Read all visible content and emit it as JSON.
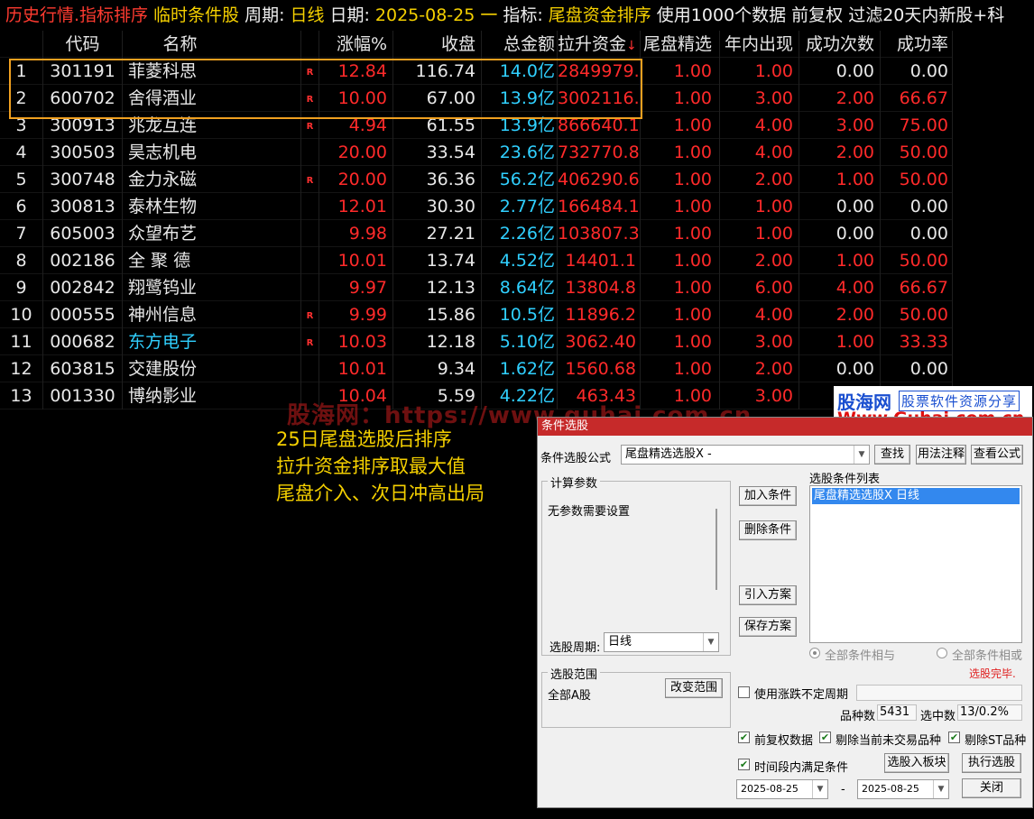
{
  "header": {
    "title": "历史行情.指标排序",
    "mode": "临时条件股",
    "period_label": "周期:",
    "period_value": "日线",
    "date_label": "日期:",
    "date_value": "2025-08-25 一",
    "indicator_label": "指标:",
    "indicator_value": "尾盘资金排序",
    "tail": "使用1000个数据 前复权 过滤20天内新股+科"
  },
  "table": {
    "columns": [
      "代码",
      "名称",
      "涨幅%",
      "收盘",
      "总金额",
      "拉升资金",
      "尾盘精选",
      "年内出现",
      "成功次数",
      "成功率"
    ],
    "sort_indicator": "↓",
    "rows": [
      {
        "idx": "1",
        "code": "301191",
        "name": "菲菱科思",
        "flag": "R",
        "chg": "12.84",
        "close": "116.74",
        "amount": "14.0亿",
        "fund": "2849979.0",
        "tail": "1.00",
        "year": "1.00",
        "succ": "0.00",
        "rate": "0.00"
      },
      {
        "idx": "2",
        "code": "600702",
        "name": "舍得酒业",
        "flag": "R",
        "chg": "10.00",
        "close": "67.00",
        "amount": "13.9亿",
        "fund": "3002116.8",
        "tail": "1.00",
        "year": "3.00",
        "succ": "2.00",
        "rate": "66.67"
      },
      {
        "idx": "3",
        "code": "300913",
        "name": "兆龙互连",
        "flag": "R",
        "chg": "4.94",
        "close": "61.55",
        "amount": "13.9亿",
        "fund": "866640.1",
        "tail": "1.00",
        "year": "4.00",
        "succ": "3.00",
        "rate": "75.00"
      },
      {
        "idx": "4",
        "code": "300503",
        "name": "昊志机电",
        "flag": "",
        "chg": "20.00",
        "close": "33.54",
        "amount": "23.6亿",
        "fund": "732770.8",
        "tail": "1.00",
        "year": "4.00",
        "succ": "2.00",
        "rate": "50.00"
      },
      {
        "idx": "5",
        "code": "300748",
        "name": "金力永磁",
        "flag": "R",
        "chg": "20.00",
        "close": "36.36",
        "amount": "56.2亿",
        "fund": "406290.6",
        "tail": "1.00",
        "year": "2.00",
        "succ": "1.00",
        "rate": "50.00"
      },
      {
        "idx": "6",
        "code": "300813",
        "name": "泰林生物",
        "flag": "",
        "chg": "12.01",
        "close": "30.30",
        "amount": "2.77亿",
        "fund": "166484.1",
        "tail": "1.00",
        "year": "1.00",
        "succ": "0.00",
        "rate": "0.00"
      },
      {
        "idx": "7",
        "code": "605003",
        "name": "众望布艺",
        "flag": "",
        "chg": "9.98",
        "close": "27.21",
        "amount": "2.26亿",
        "fund": "103807.3",
        "tail": "1.00",
        "year": "1.00",
        "succ": "0.00",
        "rate": "0.00"
      },
      {
        "idx": "8",
        "code": "002186",
        "name": "全 聚 德",
        "flag": "",
        "chg": "10.01",
        "close": "13.74",
        "amount": "4.52亿",
        "fund": "14401.1",
        "tail": "1.00",
        "year": "2.00",
        "succ": "1.00",
        "rate": "50.00"
      },
      {
        "idx": "9",
        "code": "002842",
        "name": "翔鹭钨业",
        "flag": "",
        "chg": "9.97",
        "close": "12.13",
        "amount": "8.64亿",
        "fund": "13804.8",
        "tail": "1.00",
        "year": "6.00",
        "succ": "4.00",
        "rate": "66.67"
      },
      {
        "idx": "10",
        "code": "000555",
        "name": "神州信息",
        "flag": "R",
        "chg": "9.99",
        "close": "15.86",
        "amount": "10.5亿",
        "fund": "11896.2",
        "tail": "1.00",
        "year": "4.00",
        "succ": "2.00",
        "rate": "50.00"
      },
      {
        "idx": "11",
        "code": "000682",
        "name": "东方电子",
        "flag": "R",
        "chg": "10.03",
        "close": "12.18",
        "amount": "5.10亿",
        "fund": "3062.40",
        "tail": "1.00",
        "year": "3.00",
        "succ": "1.00",
        "rate": "33.33"
      },
      {
        "idx": "12",
        "code": "603815",
        "name": "交建股份",
        "flag": "",
        "chg": "10.01",
        "close": "9.34",
        "amount": "1.62亿",
        "fund": "1560.68",
        "tail": "1.00",
        "year": "2.00",
        "succ": "0.00",
        "rate": "0.00"
      },
      {
        "idx": "13",
        "code": "001330",
        "name": "博纳影业",
        "flag": "",
        "chg": "10.04",
        "close": "5.59",
        "amount": "4.22亿",
        "fund": "463.43",
        "tail": "1.00",
        "year": "3.00",
        "succ": "",
        "rate": ""
      }
    ]
  },
  "watermark": "股海网：https://www.guhai.com.cn",
  "notes": [
    "25日尾盘选股后排序",
    "拉升资金排序取最大值",
    "尾盘介入、次日冲高出局"
  ],
  "logo": {
    "name": "股海网",
    "slogan": "股票软件资源分享",
    "url": "Www.Guhai.com.cn"
  },
  "dialog": {
    "title": "条件选股",
    "formula_label": "条件选股公式",
    "formula_value": "尾盘精选选股X  -",
    "btn_find": "查找",
    "btn_usage": "用法注释",
    "btn_view": "查看公式",
    "params_group": "计算参数",
    "params_text": "无参数需要设置",
    "period_label": "选股周期:",
    "period_value": "日线",
    "btn_add": "加入条件",
    "btn_delete": "删除条件",
    "btn_import": "引入方案",
    "btn_save": "保存方案",
    "list_label": "选股条件列表",
    "list_items": [
      "尾盘精选选股X  日线"
    ],
    "radio_and": "全部条件相与",
    "radio_or": "全部条件相或",
    "status": "选股完毕.",
    "scope_group": "选股范围",
    "scope_value": "全部A股",
    "btn_scope": "改变范围",
    "chk_irregular": "使用涨跌不定周期",
    "count_label": "品种数",
    "count_value": "5431",
    "selected_label": "选中数",
    "selected_value": "13/0.2%",
    "chk_adjust": "前复权数据",
    "chk_exclude_untraded": "剔除当前未交易品种",
    "chk_exclude_st": "剔除ST品种",
    "chk_timerange": "时间段内满足条件",
    "btn_to_block": "选股入板块",
    "btn_run": "执行选股",
    "date_from": "2025-08-25",
    "date_sep": "-",
    "date_to": "2025-08-25",
    "btn_close": "关闭"
  },
  "colors": {
    "up": "#ff2a2a",
    "amount": "#30d0ff",
    "header_accent": "#f5d000",
    "selection_border": "#f0a020"
  }
}
